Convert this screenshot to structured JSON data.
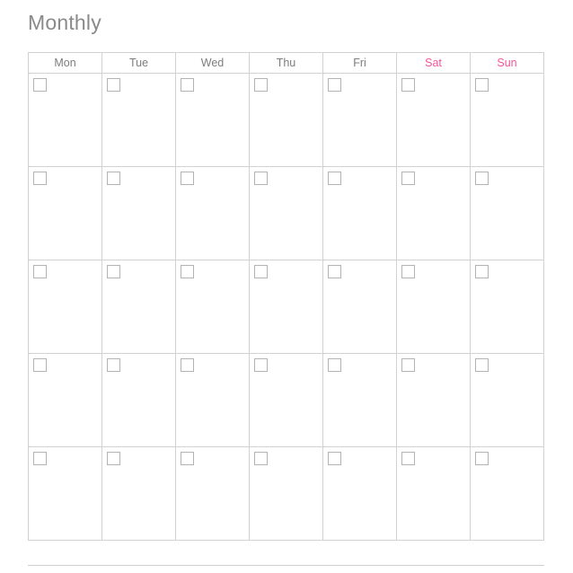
{
  "page": {
    "title": "Monthly",
    "accent_color": "#f4559a",
    "text_color": "#7d7d7d",
    "border_color": "#d2d2d2",
    "checkbox_border_color": "#b3b3b3",
    "background": "#ffffff"
  },
  "calendar": {
    "columns": [
      {
        "label": "Mon",
        "weekend": false
      },
      {
        "label": "Tue",
        "weekend": false
      },
      {
        "label": "Wed",
        "weekend": false
      },
      {
        "label": "Thu",
        "weekend": false
      },
      {
        "label": "Fri",
        "weekend": false
      },
      {
        "label": "Sat",
        "weekend": true
      },
      {
        "label": "Sun",
        "weekend": true
      }
    ],
    "weeks": [
      {
        "cells": [
          "",
          "",
          "",
          "",
          "",
          "",
          ""
        ]
      },
      {
        "cells": [
          "",
          "",
          "",
          "",
          "",
          "",
          ""
        ]
      },
      {
        "cells": [
          "",
          "",
          "",
          "",
          "",
          "",
          ""
        ]
      },
      {
        "cells": [
          "",
          "",
          "",
          "",
          "",
          "",
          ""
        ]
      },
      {
        "cells": [
          "",
          "",
          "",
          "",
          "",
          "",
          ""
        ]
      }
    ],
    "row_count": 5,
    "column_count": 7
  }
}
